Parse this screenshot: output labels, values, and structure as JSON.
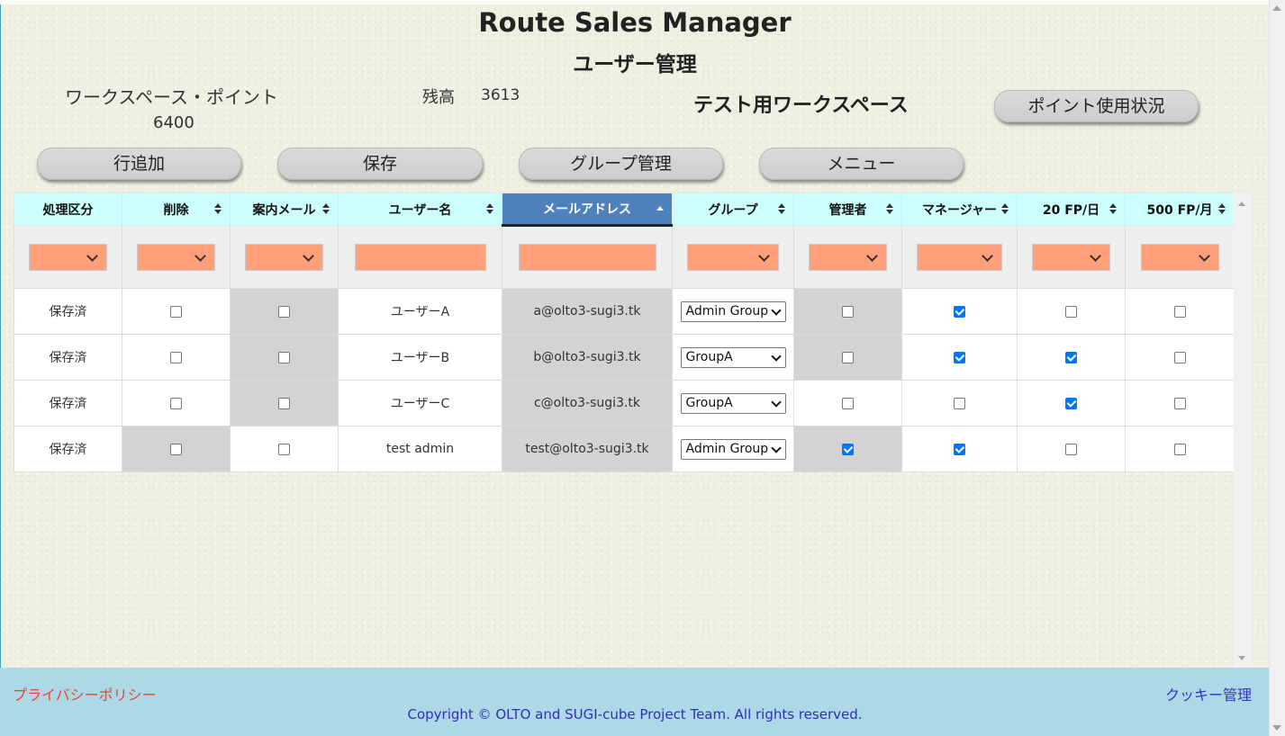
{
  "app_title": "Route Sales Manager",
  "page_subtitle": "ユーザー管理",
  "workspace": {
    "points_label": "ワークスペース・ポイント",
    "points_value": "6400",
    "balance_label": "残高",
    "balance_value": "3613",
    "name": "テスト用ワークスペース"
  },
  "buttons": {
    "point_usage": "ポイント使用状況",
    "add_row": "行追加",
    "save": "保存",
    "group_manage": "グループ管理",
    "menu": "メニュー"
  },
  "table": {
    "headers": [
      "処理区分",
      "削除",
      "案内メール",
      "ユーザー名",
      "メールアドレス",
      "グループ",
      "管理者",
      "マネージャー",
      "20 FP/日",
      "500 FP/月"
    ],
    "rows": [
      {
        "status": "保存済",
        "delete": false,
        "invite_mail": false,
        "username": "ユーザーA",
        "email": "a@olto3-sugi3.tk",
        "group": "Admin Group",
        "admin": false,
        "manager": true,
        "fp20": false,
        "fp500": false
      },
      {
        "status": "保存済",
        "delete": false,
        "invite_mail": false,
        "username": "ユーザーB",
        "email": "b@olto3-sugi3.tk",
        "group": "GroupA",
        "admin": false,
        "manager": true,
        "fp20": true,
        "fp500": false
      },
      {
        "status": "保存済",
        "delete": false,
        "invite_mail": false,
        "username": "ユーザーC",
        "email": "c@olto3-sugi3.tk",
        "group": "GroupA",
        "admin": false,
        "manager": false,
        "fp20": true,
        "fp500": false
      },
      {
        "status": "保存済",
        "delete": false,
        "invite_mail": false,
        "username": "test admin",
        "email": "test@olto3-sugi3.tk",
        "group": "Admin Group",
        "admin": true,
        "manager": true,
        "fp20": false,
        "fp500": false
      }
    ]
  },
  "footer": {
    "privacy": "プライバシーポリシー",
    "cookie": "クッキー管理",
    "copyright": "Copyright © OLTO and SUGI-cube Project Team. All rights reserved."
  },
  "colors": {
    "header_bg": "#ccffff",
    "sorted_header_bg": "#4f81bd",
    "filter_bg": "#ffa07a",
    "locked_cell": "#d3d3d3",
    "footer_bg": "#add8e6",
    "checkbox_on": "#0075ff"
  },
  "icons": {
    "sort": "sort-both-icon",
    "sorted_asc": "sort-asc-icon",
    "dropdown": "chevron-down-icon"
  }
}
